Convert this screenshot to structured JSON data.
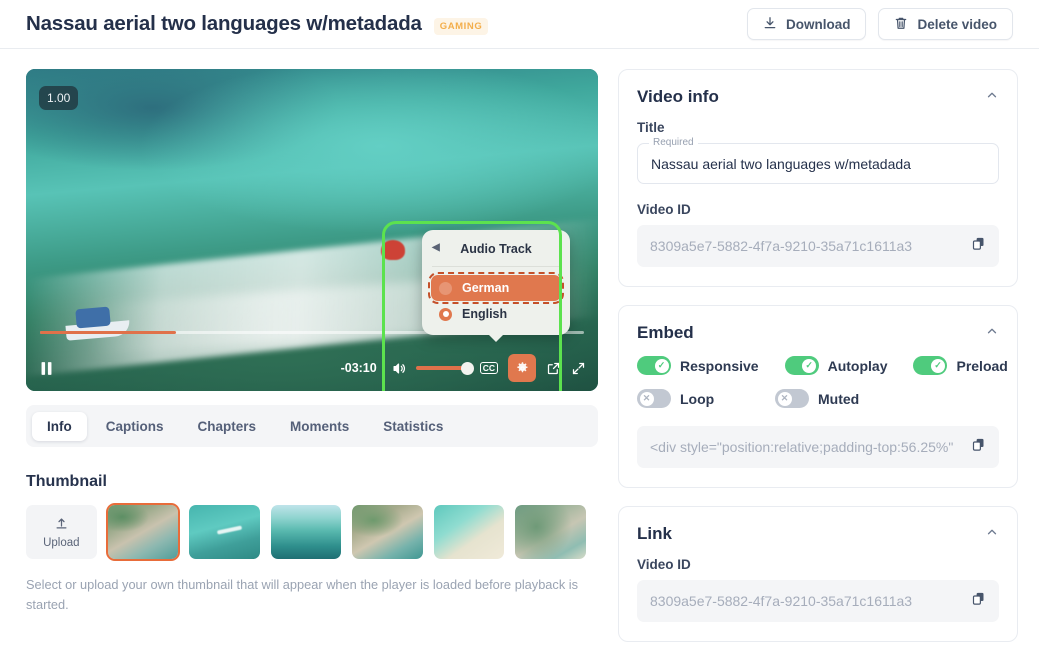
{
  "header": {
    "title": "Nassau aerial two languages w/metadada",
    "badge": "GAMING",
    "download_label": "Download",
    "delete_label": "Delete video"
  },
  "player": {
    "speed_badge": "1.00",
    "time_remaining": "-03:10",
    "progress_percent": 25,
    "volume_percent": 100,
    "settings_menu": {
      "title": "Audio Track",
      "options": [
        {
          "label": "German",
          "selected": true
        },
        {
          "label": "English",
          "selected": false
        }
      ]
    }
  },
  "tabs": [
    {
      "label": "Info",
      "active": true
    },
    {
      "label": "Captions",
      "active": false
    },
    {
      "label": "Chapters",
      "active": false
    },
    {
      "label": "Moments",
      "active": false
    },
    {
      "label": "Statistics",
      "active": false
    }
  ],
  "thumbnail": {
    "section_title": "Thumbnail",
    "upload_label": "Upload",
    "help_text": "Select or upload your own thumbnail that will appear when the player is loaded before playback is started.",
    "items": [
      {
        "name": "thumbnail-1",
        "selected": true
      },
      {
        "name": "thumbnail-2",
        "selected": false
      },
      {
        "name": "thumbnail-3",
        "selected": false
      },
      {
        "name": "thumbnail-4",
        "selected": false
      },
      {
        "name": "thumbnail-5",
        "selected": false
      },
      {
        "name": "thumbnail-6",
        "selected": false
      }
    ]
  },
  "video_info": {
    "title": "Video info",
    "title_label": "Title",
    "title_legend": "Required",
    "title_value": "Nassau aerial two languages w/metadada",
    "video_id_label": "Video ID",
    "video_id_value": "8309a5e7-5882-4f7a-9210-35a71c1611a3"
  },
  "embed": {
    "title": "Embed",
    "toggles": [
      {
        "label": "Responsive",
        "on": true
      },
      {
        "label": "Autoplay",
        "on": true
      },
      {
        "label": "Preload",
        "on": true
      },
      {
        "label": "Loop",
        "on": false
      },
      {
        "label": "Muted",
        "on": false
      }
    ],
    "code_value": "<div style=\"position:relative;padding-top:56.25%\""
  },
  "link": {
    "title": "Link",
    "video_id_label": "Video ID",
    "video_id_value": "8309a5e7-5882-4f7a-9210-35a71c1611a3"
  },
  "colors": {
    "accent_orange": "#e0784e",
    "toggle_on_green": "#4fcb7d",
    "highlight_green": "#5ce24e",
    "badge_amber": "#f3ae4b"
  }
}
